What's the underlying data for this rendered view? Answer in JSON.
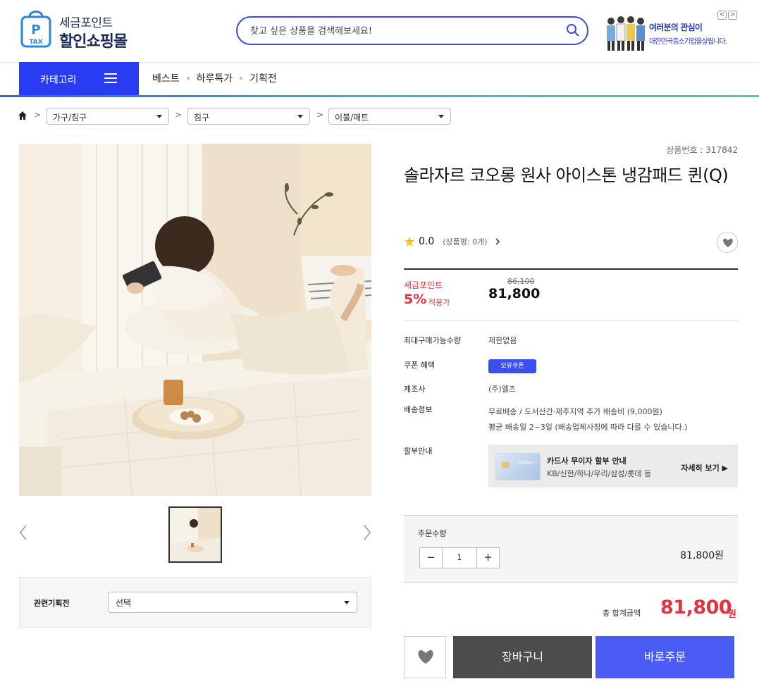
{
  "header": {
    "logo_line1": "세금포인트",
    "logo_line2": "할인쇼핑몰",
    "logo_badge_p": "P",
    "logo_badge_tax": "TAX",
    "search_placeholder": "찾고 싶은 상품을 검색해보세요!",
    "banner_line1": "여러분의 관심이",
    "banner_line2": "대한민국중소기업을살립니다.",
    "banner_prev": "<",
    "banner_next": ">"
  },
  "nav": {
    "category_label": "카테고리",
    "menu": [
      "베스트",
      "하루특가",
      "기획전"
    ]
  },
  "breadcrumb": {
    "levels": [
      "가구/침구",
      "침구",
      "이불/매트"
    ]
  },
  "gallery": {
    "related_label": "관련기획전",
    "related_select": "선택"
  },
  "product": {
    "number_text": "상품번호 : 317842",
    "title": "솔라자르 코오롱 원사 아이스톤 냉감패드 퀸(Q)",
    "rating": "0.0",
    "review_count": "(상품평: 0개)",
    "point_label": "세금포인트",
    "point_pct": "5%",
    "point_apply": "적용가",
    "original_price": "86,100",
    "sale_price": "81,800",
    "info": {
      "max_qty_label": "최대구매가능수량",
      "max_qty_value": "제한없음",
      "coupon_label": "쿠폰 혜택",
      "coupon_badge": "보유쿠폰",
      "maker_label": "제조사",
      "maker_value": "(주)엘즈",
      "ship_label": "배송정보",
      "ship_line1": "무료배송 / 도서산간·제주지역 추가 배송비 (9,000원)",
      "ship_line2": "평균 배송일 2~3일 (배송업체사정에 따라 다를 수 있습니다.)",
      "install_label": "할부안내",
      "card_title": "카드사 무이자 할부 안내",
      "card_list": "KB/신한/하나/우리/삼성/롯데 등",
      "card_more": "자세히 보기 ▶",
      "card_img_text": "CREDIT"
    }
  },
  "order": {
    "qty_label": "주문수량",
    "qty_value": "1",
    "minus": "−",
    "plus": "+",
    "line_amount": "81,800원",
    "total_label": "총 합계금액",
    "total_value": "81,800",
    "total_unit": "원",
    "cart_label": "장바구니",
    "buy_label": "바로주문"
  },
  "colors": {
    "brand_blue": "#2a3cf2",
    "accent_red": "#e0353f",
    "buy_blue": "#4a5cf4"
  }
}
